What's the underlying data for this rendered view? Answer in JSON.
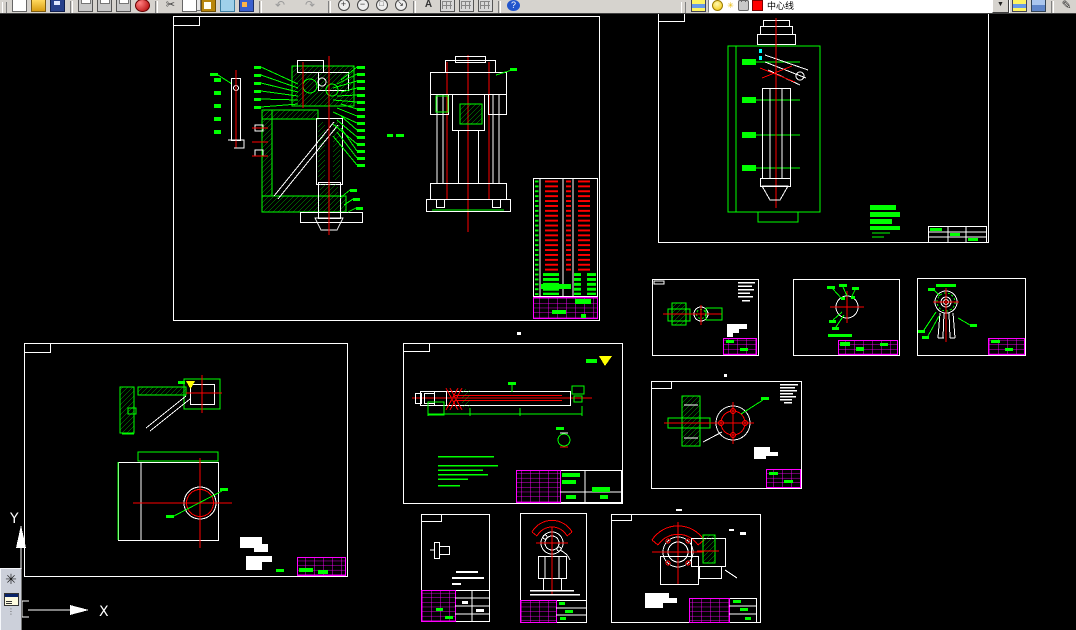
{
  "app": {
    "kind": "cad-workspace",
    "background": "#000000"
  },
  "toolbar": {
    "background": "#d6d3ce",
    "buttons": [
      "new",
      "open",
      "save",
      "plot",
      "plot-preview",
      "publish",
      "red-marker",
      "cut",
      "copy",
      "paste",
      "match-properties",
      "block-editor",
      "undo",
      "redo",
      "zoom-in",
      "zoom-out",
      "zoom-window",
      "zoom-realtime",
      "text-style",
      "designcenter",
      "tool-palettes",
      "markup-set-manager",
      "help"
    ],
    "layer_controls": {
      "toggles": [
        "layer-on-off",
        "layer-freeze",
        "layer-lock"
      ],
      "color_swatch": "#ff0000",
      "current_layer": "中心线",
      "dropdown_arrow": "▼"
    },
    "right_buttons": [
      "make-object-layer-current",
      "layer-previous",
      "pencil-edit"
    ]
  },
  "side_toolbar": {
    "buttons": [
      "render",
      "tool-palette-window"
    ],
    "more_indicator": "⋮"
  },
  "ucs": {
    "x_label": "X",
    "y_label": "Y"
  },
  "colors": {
    "geometry_white": "#ffffff",
    "geometry_green": "#00ff00",
    "centerline_red": "#ff0000",
    "titleblock_magenta": "#ff00ff",
    "finish_mark_yellow": "#ffff00",
    "detail_cyan": "#00ffff"
  },
  "sheets": [
    {
      "id": "assembly-main",
      "desc": "large assembly drawing with section views, press elevation and parts list"
    },
    {
      "id": "assembly-column",
      "desc": "vertical head/column assembly drawing"
    },
    {
      "id": "part-bracket-small",
      "desc": "small part drawing with notes block"
    },
    {
      "id": "part-disc",
      "desc": "small circular part drawing"
    },
    {
      "id": "part-clevis",
      "desc": "small clevis part drawing"
    },
    {
      "id": "part-bracket-plate",
      "desc": "bracket plate drawing with bore circle"
    },
    {
      "id": "part-shaft",
      "desc": "long shaft drawing with technical notes"
    },
    {
      "id": "part-flange",
      "desc": "flange drawing with bolt circle"
    },
    {
      "id": "part-pin",
      "desc": "small pin part sheet"
    },
    {
      "id": "part-cam",
      "desc": "small cam segment sheet"
    },
    {
      "id": "part-cam-housing",
      "desc": "cam and housing section sheet"
    }
  ]
}
